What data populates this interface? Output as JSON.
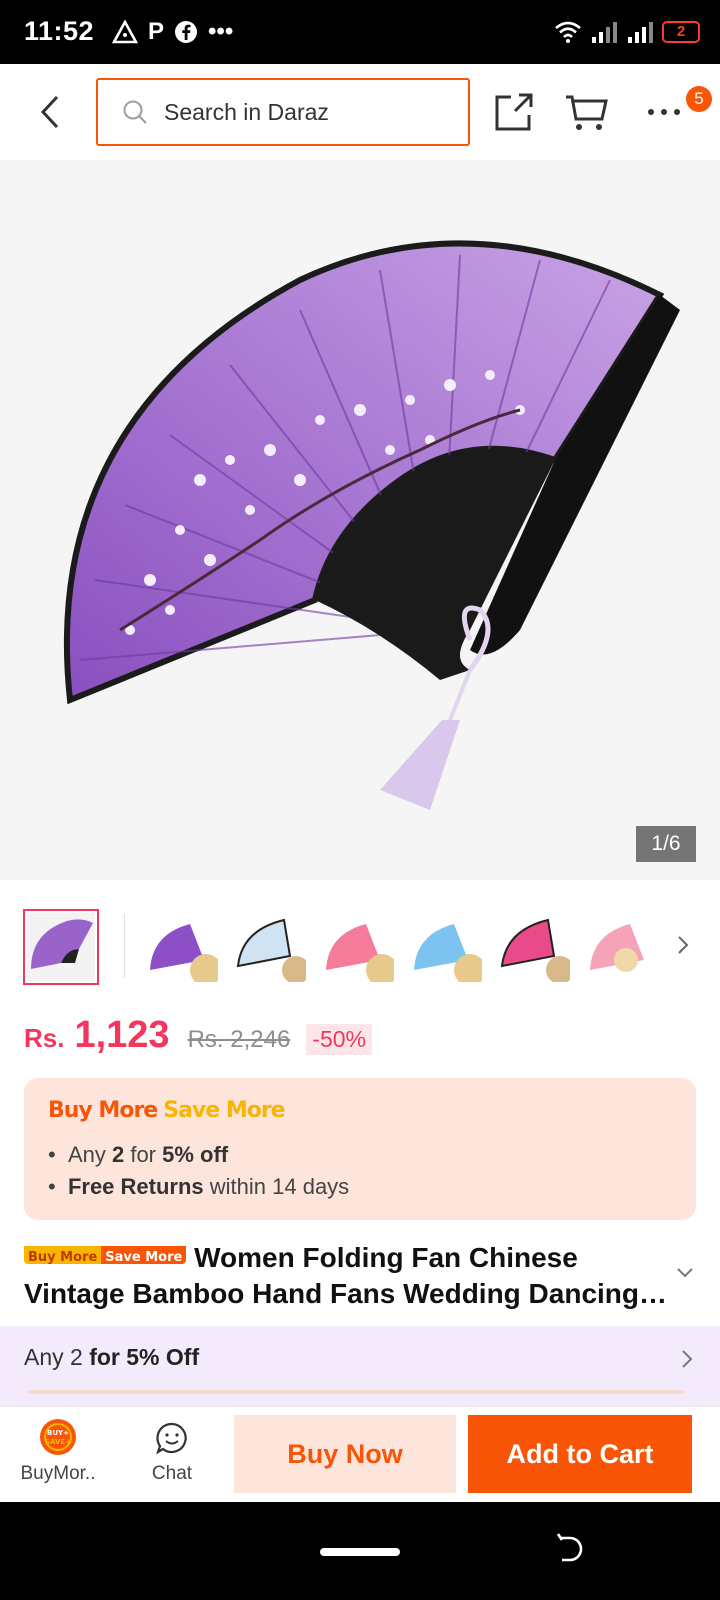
{
  "status_bar": {
    "time": "11:52",
    "left_icons": [
      "warning-triangle-icon",
      "p-app-icon",
      "facebook-icon",
      "more-dots-icon"
    ],
    "p_glyph": "P",
    "more_dots": "•••",
    "battery": "2"
  },
  "header": {
    "search_placeholder": "Search in Daraz",
    "more_badge": "5"
  },
  "gallery": {
    "counter": "1/6",
    "thumb_count": 7
  },
  "price": {
    "currency": "Rs.",
    "current": "1,123",
    "original": "Rs. 2,246",
    "discount": "-50%"
  },
  "promo": {
    "title_a": "Buy More",
    "title_b": "Save More",
    "line1_pre": "Any ",
    "line1_num": "2",
    "line1_mid": " for ",
    "line1_bold": "5% off",
    "line2_bold": "Free Returns",
    "line2_rest": " within 14 days"
  },
  "product": {
    "badge_a": "Buy More",
    "badge_b": "Save More",
    "title": "Women Folding Fan Chinese Vintage Bamboo Hand Fans Wedding Dancing Party Decor"
  },
  "deal": {
    "pre": "Any 2 ",
    "bold": "for 5% Off"
  },
  "bottom_bar": {
    "buymore_label": "BuyMor..",
    "buymore_icon_top": "BUY+",
    "buymore_icon_bottom": "SAVE+",
    "chat_label": "Chat",
    "buy_now": "Buy Now",
    "add_to_cart": "Add to Cart"
  },
  "colors": {
    "brand_orange": "#f85606",
    "price_pink": "#f5365c",
    "fan_purple": "#9a63c9"
  }
}
